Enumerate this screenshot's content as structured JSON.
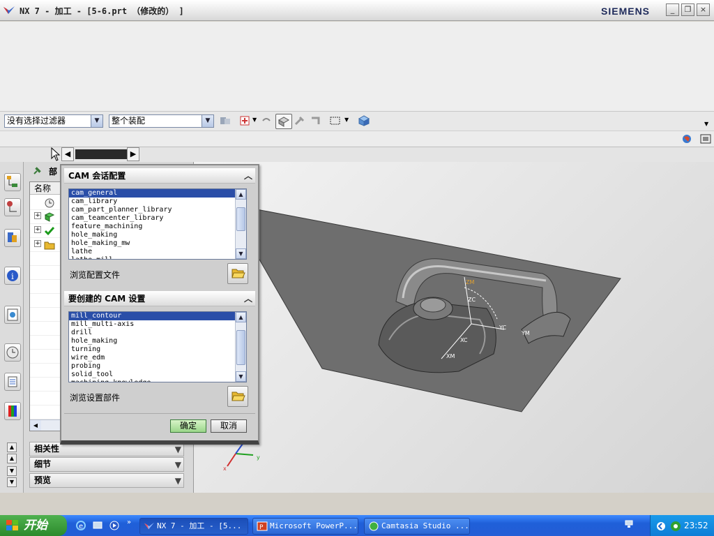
{
  "window": {
    "title": "NX 7 - 加工 - [5-6.prt （修改的） ]",
    "brand": "SIEMENS",
    "controls": {
      "minimize": "_",
      "restore": "❐",
      "close": "×"
    }
  },
  "toolbar": {
    "filter_value": "没有选择过滤器",
    "scope_value": "整个装配"
  },
  "navigator": {
    "header_label": "部",
    "column_name": "名称"
  },
  "sections": {
    "relevance": "相关性",
    "details": "细节",
    "preview": "预览"
  },
  "dialog": {
    "section1_title": "CAM 会话配置",
    "config_items": [
      "cam_general",
      "cam_library",
      "cam_part_planner_library",
      "cam_teamcenter_library",
      "feature_machining",
      "hole_making",
      "hole_making_mw",
      "lathe",
      "lathe_mill"
    ],
    "config_selected": 0,
    "browse_config": "浏览配置文件",
    "section2_title": "要创建的 CAM 设置",
    "setup_items": [
      "mill_contour",
      "mill_multi-axis",
      "drill",
      "hole_making",
      "turning",
      "wire_edm",
      "probing",
      "solid_tool",
      "machining_knowledge"
    ],
    "setup_selected": 0,
    "browse_setup": "浏览设置部件",
    "ok_label": "确定",
    "cancel_label": "取消"
  },
  "viewport": {
    "axis_labels": {
      "zm": "ZM",
      "zc": "ZC",
      "yc": "YC",
      "xc": "XC",
      "xm": "XM",
      "ym": "YM"
    },
    "triad": {
      "x": "x",
      "y": "y"
    }
  },
  "taskbar": {
    "start_label": "开始",
    "tasks": [
      "NX 7 - 加工 - [5...",
      "Microsoft PowerP...",
      "Camtasia Studio ..."
    ],
    "clock": "23:52"
  },
  "colors": {
    "accent": "#2a4ea8",
    "taskbar": "#245ed6",
    "start": "#2c8a2c",
    "ok_button": "#b5e6a8",
    "part_surface": "#6f6f6f"
  }
}
